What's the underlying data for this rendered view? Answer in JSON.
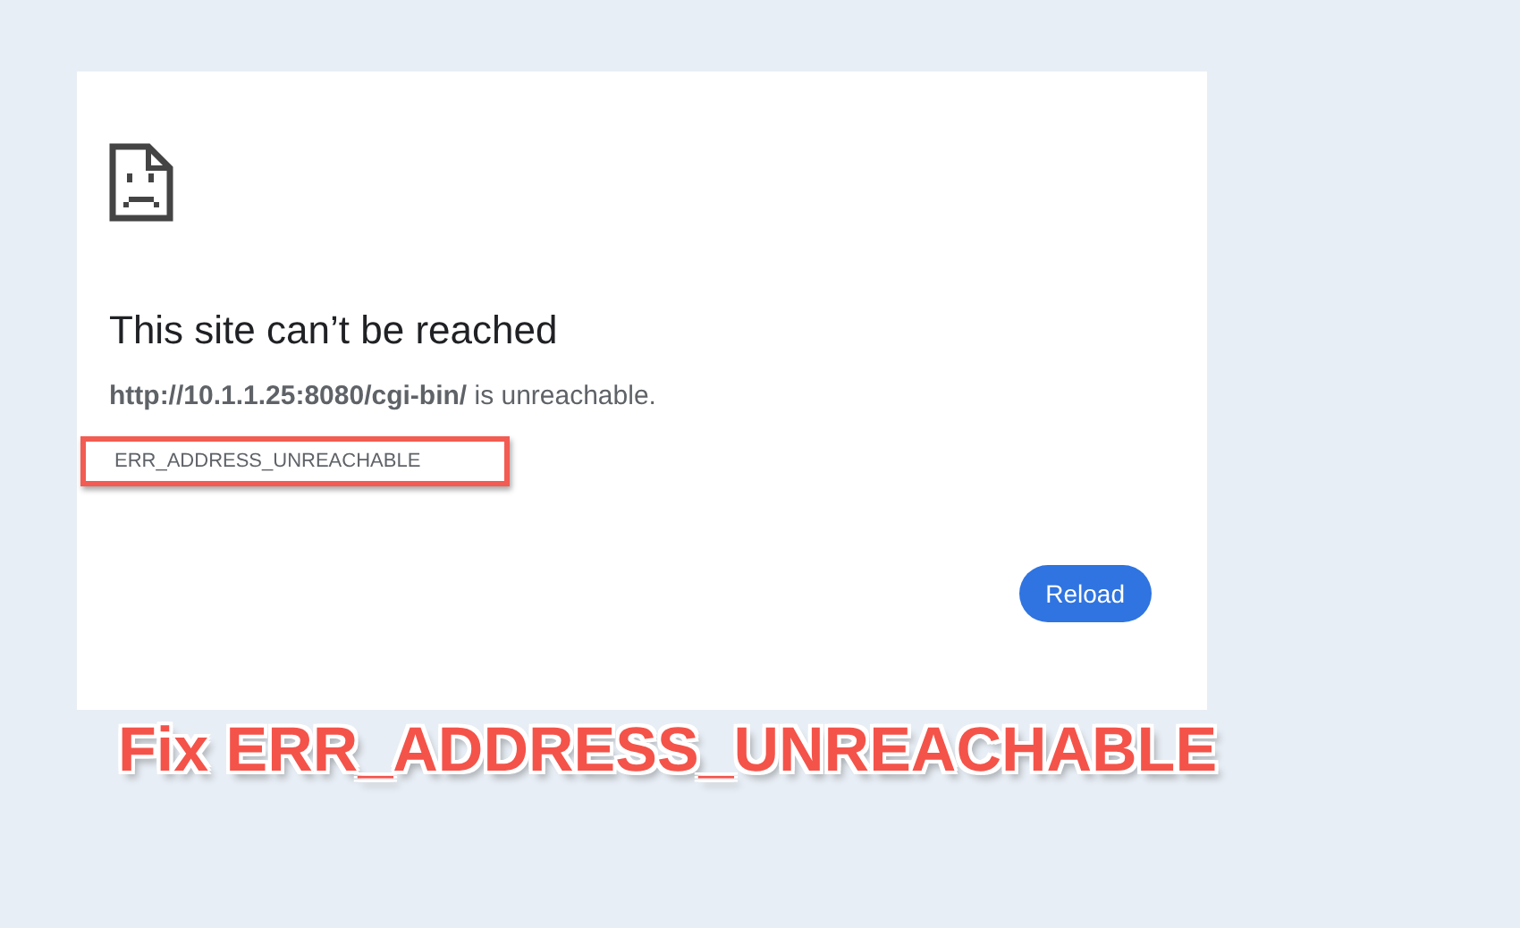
{
  "error_page": {
    "heading": "This site can’t be reached",
    "message": "**http://10.1.1.25:8080/cgi-bin/** is unreachable.",
    "error_code": "ERR_ADDRESS_UNREACHABLE",
    "error_code_highlighted": true,
    "button": "Reload"
  },
  "caption": "Fix ERR_ADDRESS_UNREACHABLE"
}
